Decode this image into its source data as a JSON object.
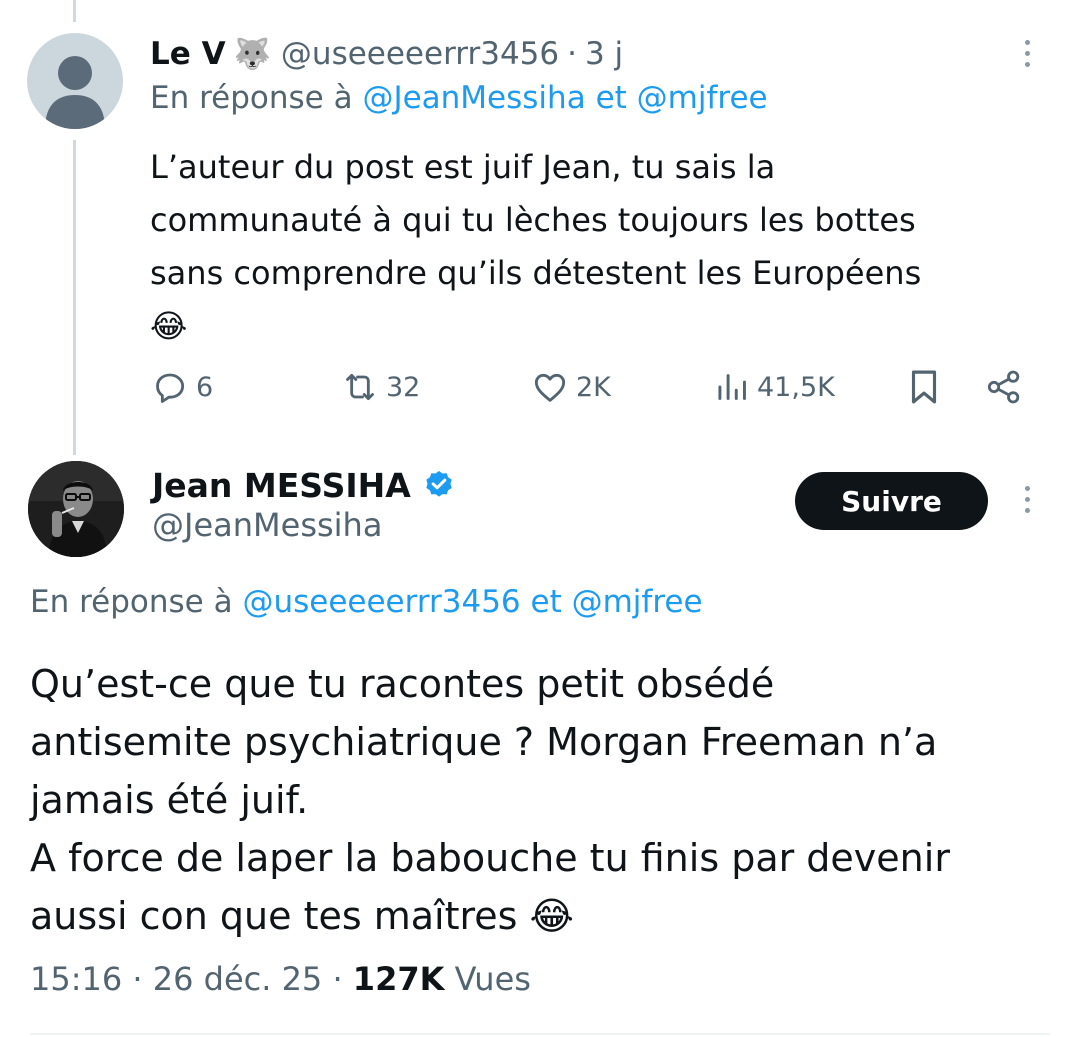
{
  "reply_tweet": {
    "author_name": "Le V",
    "author_emoji": "🐺",
    "handle": "@useeeeerrr3456",
    "separator": "·",
    "time": "3 j",
    "replying_prefix": "En réponse à",
    "replying_mention_1": "@JeanMessiha",
    "replying_joiner": "et",
    "replying_mention_2": "@mjfree",
    "text_lines": [
      "L’auteur du post est juif Jean, tu sais la",
      "communauté à qui tu lèches toujours les bottes",
      "sans comprendre qu’ils détestent les Européens",
      "😂"
    ],
    "stats": {
      "replies": "6",
      "reposts": "32",
      "likes": "2K",
      "views": "41,5K"
    }
  },
  "main_tweet": {
    "author_name": "Jean MESSIHA",
    "handle": "@JeanMessiha",
    "follow_label": "Suivre",
    "replying_prefix": "En réponse à",
    "replying_mention_1": "@useeeeerrr3456",
    "replying_joiner": "et",
    "replying_mention_2": "@mjfree",
    "text_lines": [
      "Qu’est-ce que tu racontes petit obsédé",
      "antisemite psychiatrique ? Morgan Freeman n’a",
      "jamais été juif.",
      "A force de laper la babouche tu finis par devenir",
      "aussi con que tes maîtres 😂"
    ],
    "time": "15:16",
    "separator": "·",
    "date": "26 déc. 25",
    "views_count": "127K",
    "views_label": "Vues"
  },
  "colors": {
    "text": "#0f1419",
    "secondary": "#536471",
    "link": "#1d9bf0",
    "verified": "#1d9bf0",
    "button_bg": "#0f1419",
    "thread_line": "#cfd9de"
  },
  "icons": {
    "reply": "speech-bubble-icon",
    "repost": "repost-arrows-icon",
    "like": "heart-icon",
    "views": "bar-chart-icon",
    "bookmark": "bookmark-icon",
    "share": "share-icon",
    "verified": "verified-badge-icon",
    "more": "vertical-dots-icon"
  }
}
